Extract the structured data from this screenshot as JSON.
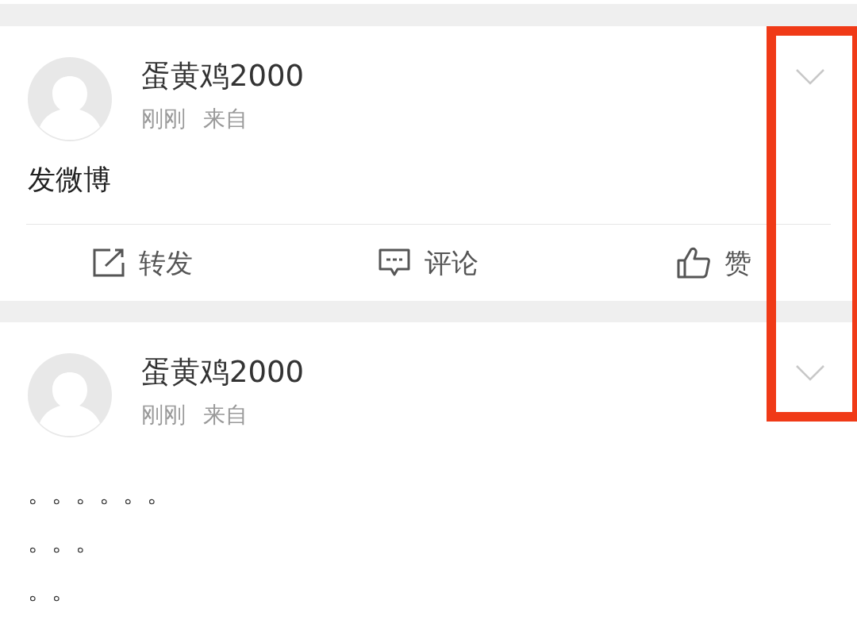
{
  "posts": [
    {
      "author": "蛋黄鸡2000",
      "time": "刚刚",
      "source": "来自",
      "body": [
        "发微博"
      ],
      "actions": [
        {
          "kind": "repost",
          "label": "转发"
        },
        {
          "kind": "comment",
          "label": "评论"
        },
        {
          "kind": "like",
          "label": "赞"
        }
      ]
    },
    {
      "author": "蛋黄鸡2000",
      "time": "刚刚",
      "source": "来自",
      "body": [
        "。。。。。。",
        "。。。",
        "。。"
      ]
    }
  ],
  "highlight": {
    "shown": true,
    "color": "#f03a17"
  }
}
